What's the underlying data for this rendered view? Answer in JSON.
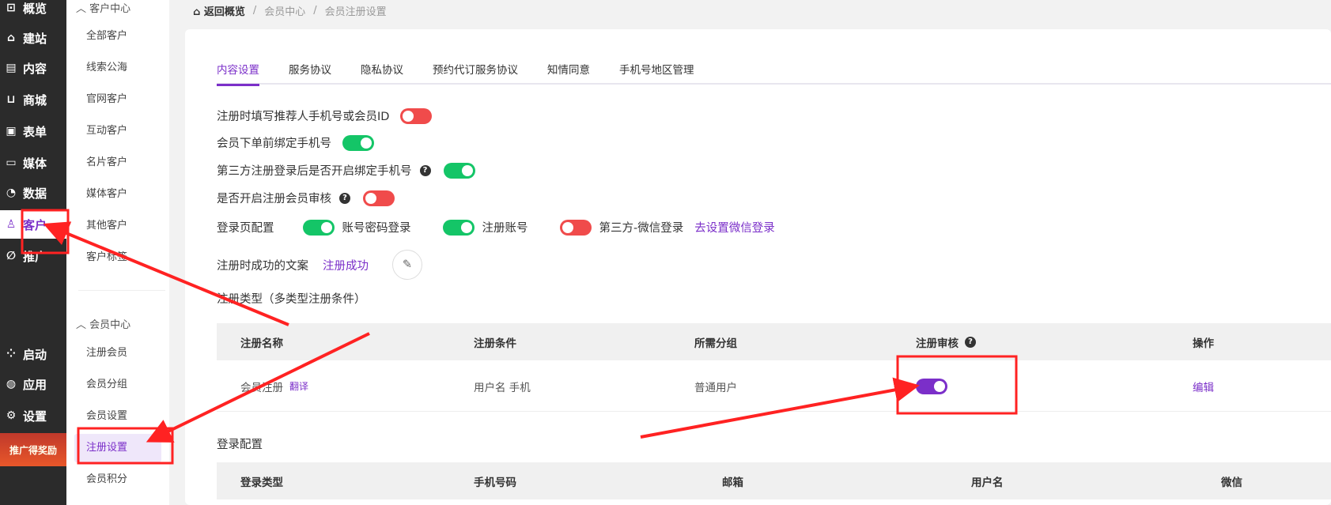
{
  "nav": [
    {
      "label": "概览",
      "icon": "chart-icon"
    },
    {
      "label": "建站",
      "icon": "home-icon"
    },
    {
      "label": "内容",
      "icon": "document-icon"
    },
    {
      "label": "商城",
      "icon": "cart-icon"
    },
    {
      "label": "表单",
      "icon": "form-icon"
    },
    {
      "label": "媒体",
      "icon": "video-icon"
    },
    {
      "label": "数据",
      "icon": "pie-icon"
    },
    {
      "label": "客户",
      "icon": "user-icon"
    },
    {
      "label": "推广",
      "icon": "paperclip-icon"
    },
    {
      "label": "启动",
      "icon": "dots-icon"
    },
    {
      "label": "应用",
      "icon": "apps-icon"
    },
    {
      "label": "设置",
      "icon": "gear-icon"
    }
  ],
  "promo_banner": "推广得奖励",
  "sub": {
    "group1": "客户中心",
    "items1": [
      "全部客户",
      "线索公海",
      "官网客户",
      "互动客户",
      "名片客户",
      "媒体客户",
      "其他客户",
      "客户标签"
    ],
    "group2": "会员中心",
    "items2": [
      "注册会员",
      "会员分组",
      "会员设置",
      "注册设置",
      "会员积分"
    ]
  },
  "breadcrumb": {
    "home": "返回概览",
    "items": [
      "会员中心",
      "会员注册设置"
    ]
  },
  "tabs": [
    "内容设置",
    "服务协议",
    "隐私协议",
    "预约代订服务协议",
    "知情同意",
    "手机号地区管理"
  ],
  "settings": {
    "referrer": {
      "label": "注册时填写推荐人手机号或会员ID",
      "on": false
    },
    "bind_phone": {
      "label": "会员下单前绑定手机号",
      "on": true
    },
    "third_bind": {
      "label": "第三方注册登录后是否开启绑定手机号",
      "on": true
    },
    "audit": {
      "label": "是否开启注册会员审核",
      "on": false
    },
    "login_page": {
      "label": "登录页配置",
      "options": [
        {
          "label": "账号密码登录",
          "on": true
        },
        {
          "label": "注册账号",
          "on": true
        },
        {
          "label": "第三方-微信登录",
          "on": false
        }
      ],
      "link": "去设置微信登录"
    },
    "success_text": {
      "label": "注册时成功的文案",
      "value": "注册成功"
    }
  },
  "reg_type": {
    "title": "注册类型（多类型注册条件）",
    "headers": [
      "注册名称",
      "注册条件",
      "所需分组",
      "注册审核",
      "操作"
    ],
    "rows": [
      {
        "name": "会员注册",
        "translate": "翻译",
        "condition": "用户名 手机",
        "group": "普通用户",
        "audit": true,
        "action": "编辑"
      }
    ]
  },
  "login_config": {
    "title": "登录配置",
    "headers": [
      "登录类型",
      "手机号码",
      "邮箱",
      "用户名",
      "微信"
    ]
  }
}
